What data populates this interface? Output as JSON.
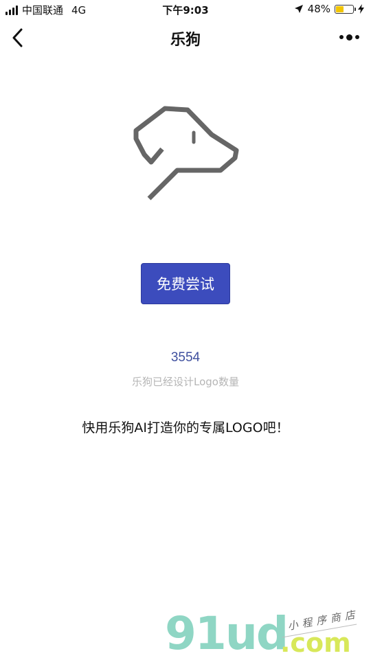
{
  "status_bar": {
    "carrier": "中国联通",
    "network": "4G",
    "time": "下午9:03",
    "battery_percent_text": "48%",
    "battery_level": 0.48,
    "battery_color": "#f2c500"
  },
  "nav": {
    "title": "乐狗",
    "back_icon": "chevron-left-icon",
    "more_icon": "more-dots-icon"
  },
  "logo": {
    "icon": "dog-head-icon",
    "color": "#666666"
  },
  "cta": {
    "label": "免费尝试",
    "color": "#3c4cbd"
  },
  "stats": {
    "count": "3554",
    "label": "乐狗已经设计Logo数量"
  },
  "slogan": "快用乐狗AI打造你的专属LOGO吧！",
  "watermark": {
    "main": "91ud",
    "domain": ".com",
    "sub": "小程序商店"
  }
}
